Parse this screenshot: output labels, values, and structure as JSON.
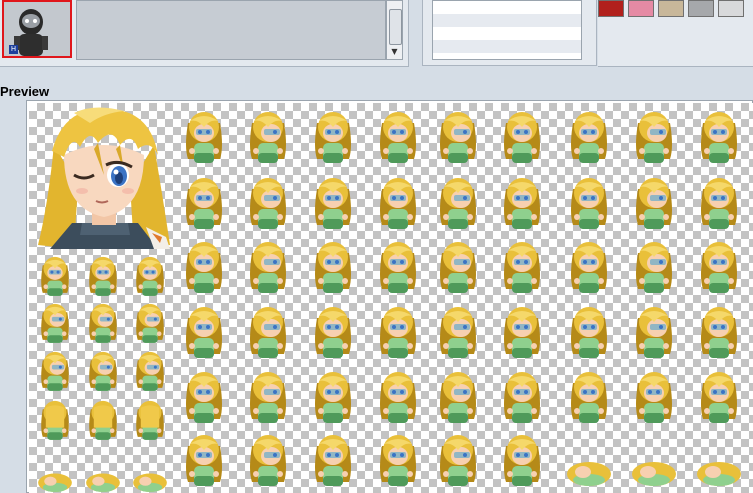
{
  "preview": {
    "title": "Preview"
  },
  "thumbnail": {
    "badge": "H"
  },
  "scrollbar": {
    "down_glyph": "▼"
  },
  "palette": {
    "swatches": [
      {
        "name": "red",
        "color": "#b1201c"
      },
      {
        "name": "pink",
        "color": "#e58aa4"
      },
      {
        "name": "tan",
        "color": "#c8b79a"
      },
      {
        "name": "gray",
        "color": "#a6a8ab"
      },
      {
        "name": "light-gray",
        "color": "#d8d9db"
      }
    ]
  },
  "colors": {
    "hair": "#e9c03a",
    "hair_shadow": "#b58a18",
    "skin": "#f7d0b0",
    "robe": "#8fd08e",
    "robe_shadow": "#4f9a5a",
    "eyes": "#3b73c4"
  }
}
